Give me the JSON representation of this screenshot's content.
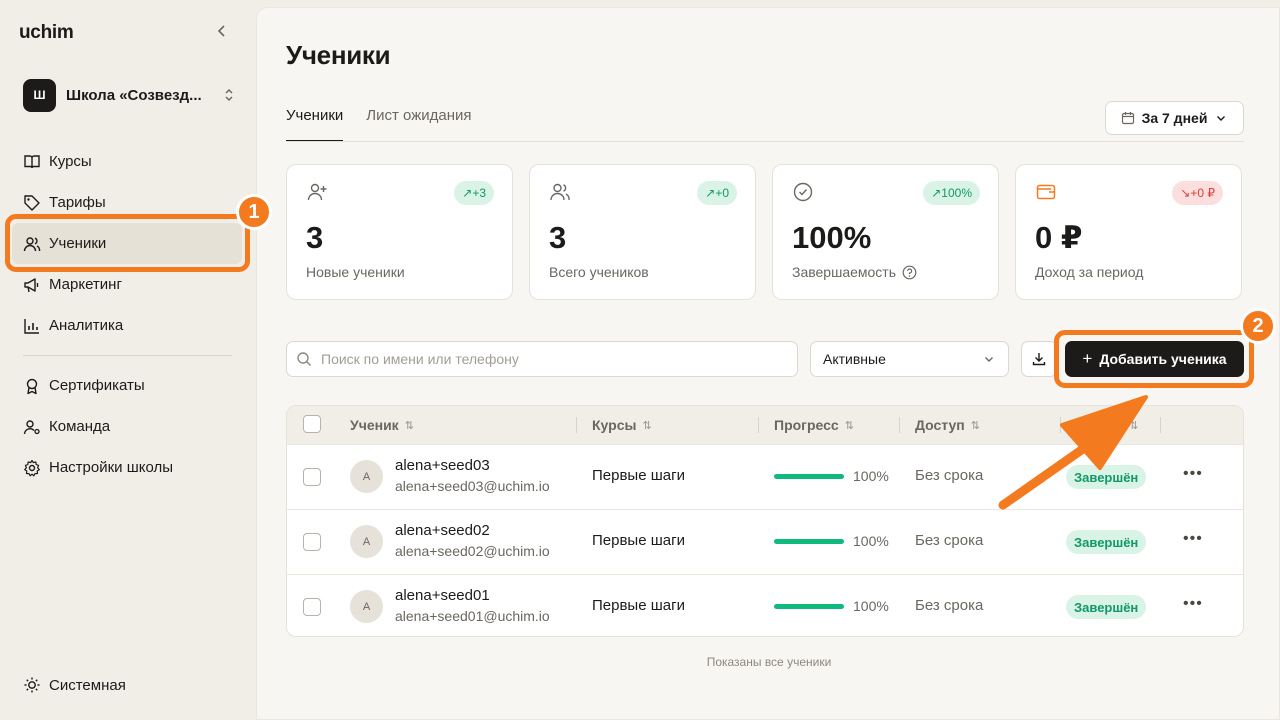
{
  "app": {
    "brand": "uchim"
  },
  "school": {
    "avatar": "Ш",
    "name": "Школа «Созвезд..."
  },
  "nav": {
    "items": [
      {
        "label": "Курсы",
        "icon": "book-icon"
      },
      {
        "label": "Тарифы",
        "icon": "tag-icon"
      },
      {
        "label": "Ученики",
        "icon": "users-icon",
        "active": true
      },
      {
        "label": "Маркетинг",
        "icon": "megaphone-icon"
      },
      {
        "label": "Аналитика",
        "icon": "chart-icon"
      }
    ],
    "secondary": [
      {
        "label": "Сертификаты",
        "icon": "award-icon"
      },
      {
        "label": "Команда",
        "icon": "team-icon"
      },
      {
        "label": "Настройки школы",
        "icon": "gear-icon"
      }
    ],
    "theme_label": "Системная"
  },
  "page": {
    "title": "Ученики",
    "tabs": [
      {
        "label": "Ученики",
        "active": true
      },
      {
        "label": "Лист ожидания"
      }
    ],
    "period_label": "За 7 дней"
  },
  "stats": [
    {
      "value": "3",
      "label": "Новые ученики",
      "badge": "+3",
      "trend": "up"
    },
    {
      "value": "3",
      "label": "Всего учеников",
      "badge": "+0",
      "trend": "up"
    },
    {
      "value": "100%",
      "label": "Завершаемость",
      "badge": "100%",
      "trend": "up"
    },
    {
      "value": "0 ₽",
      "label": "Доход за период",
      "badge": "+0 ₽",
      "trend": "down"
    }
  ],
  "toolbar": {
    "search_placeholder": "Поиск по имени или телефону",
    "filter_value": "Активные",
    "add_label": "Добавить ученика"
  },
  "table": {
    "columns": [
      "Ученик",
      "Курсы",
      "Прогресс",
      "Доступ",
      "Статус"
    ],
    "rows": [
      {
        "initial": "A",
        "name": "alena+seed03",
        "email": "alena+seed03@uchim.io",
        "course": "Первые шаги",
        "progress": 100,
        "progress_label": "100%",
        "access": "Без срока",
        "status": "Завершён"
      },
      {
        "initial": "A",
        "name": "alena+seed02",
        "email": "alena+seed02@uchim.io",
        "course": "Первые шаги",
        "progress": 100,
        "progress_label": "100%",
        "access": "Без срока",
        "status": "Завершён"
      },
      {
        "initial": "A",
        "name": "alena+seed01",
        "email": "alena+seed01@uchim.io",
        "course": "Первые шаги",
        "progress": 100,
        "progress_label": "100%",
        "access": "Без срока",
        "status": "Завершён"
      }
    ],
    "footer": "Показаны все ученики"
  },
  "annotations": {
    "step1": "1",
    "step2": "2",
    "color": "#f47a1f"
  }
}
